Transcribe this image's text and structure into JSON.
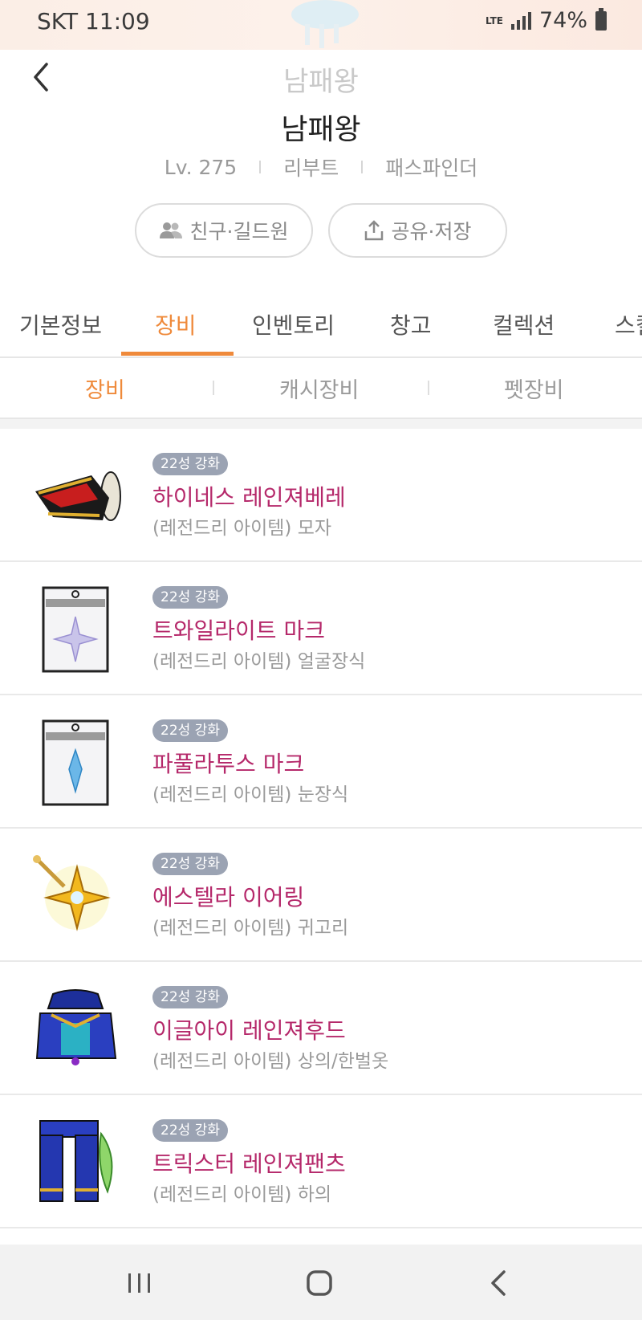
{
  "status": {
    "carrier_time": "SKT 11:09",
    "network": "LTE",
    "battery": "74%"
  },
  "header": {
    "ghost_title": "남패왕",
    "name": "남패왕",
    "level": "Lv. 275",
    "world": "리부트",
    "job": "패스파인더",
    "friends_button": "친구·길드원",
    "share_button": "공유·저장"
  },
  "tabs": [
    "기본정보",
    "장비",
    "인벤토리",
    "창고",
    "컬렉션",
    "스킬"
  ],
  "active_tab": "장비",
  "subtabs": [
    "장비",
    "캐시장비",
    "펫장비"
  ],
  "items": [
    {
      "badge": "22성 강화",
      "name": "하이네스 레인져베레",
      "desc": "(레전드리 아이템) 모자",
      "icon": "ranger-beret-icon"
    },
    {
      "badge": "22성 강화",
      "name": "트와일라이트 마크",
      "desc": "(레전드리 아이템) 얼굴장식",
      "icon": "twilight-mark-icon"
    },
    {
      "badge": "22성 강화",
      "name": "파풀라투스 마크",
      "desc": "(레전드리 아이템) 눈장식",
      "icon": "papulatus-mark-icon"
    },
    {
      "badge": "22성 강화",
      "name": "에스텔라 이어링",
      "desc": "(레전드리 아이템) 귀고리",
      "icon": "estella-earring-icon"
    },
    {
      "badge": "22성 강화",
      "name": "이글아이 레인져후드",
      "desc": "(레전드리 아이템) 상의/한벌옷",
      "icon": "eagle-eye-hood-icon"
    },
    {
      "badge": "22성 강화",
      "name": "트릭스터 레인져팬츠",
      "desc": "(레전드리 아이템) 하의",
      "icon": "trickster-pants-icon"
    }
  ],
  "colors": {
    "accent": "#ef8a3b",
    "item_name": "#b5286a",
    "badge_bg": "#9ba3b3"
  }
}
